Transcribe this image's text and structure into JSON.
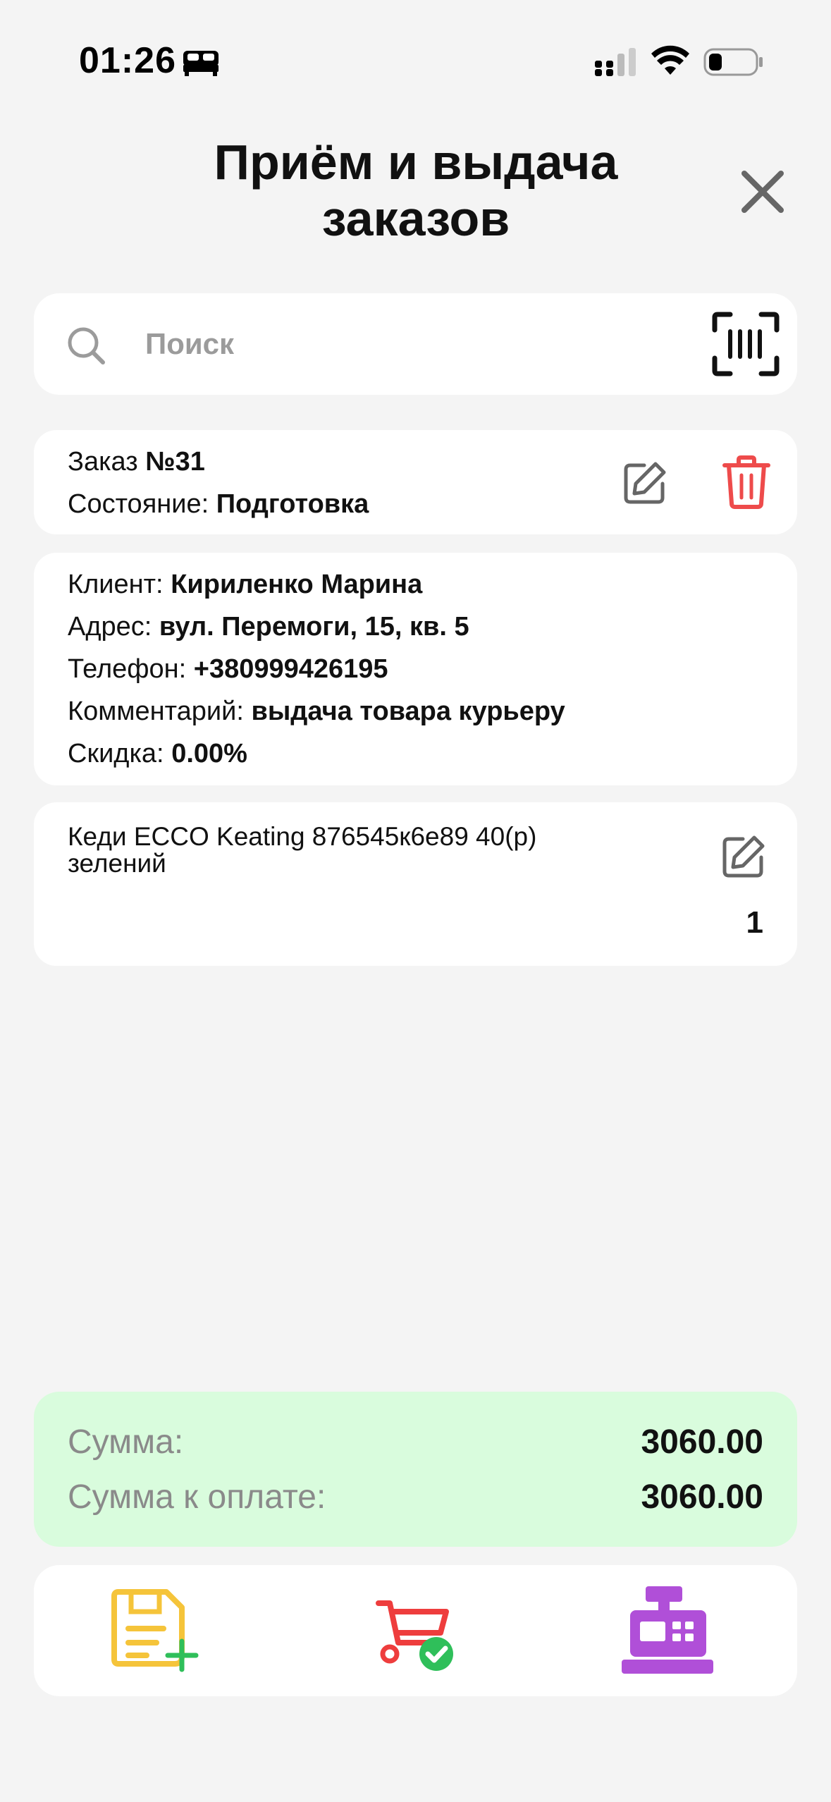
{
  "status_bar": {
    "time": "01:26",
    "mode_icon": "bed-icon",
    "icons": [
      "signal-icon",
      "wifi-icon",
      "battery-icon"
    ]
  },
  "header": {
    "title": "Приём и выдача заказов",
    "close_icon": "close-icon"
  },
  "search": {
    "placeholder": "Поиск",
    "value": "",
    "scan_icon": "barcode-scan-icon"
  },
  "order": {
    "number_label": "Заказ",
    "number_value": "№31",
    "state_label": "Состояние:",
    "state_value": "Подготовка"
  },
  "client": {
    "name_label": "Клиент:",
    "name_value": "Кириленко Марина",
    "address_label": "Адрес:",
    "address_value": "вул. Перемоги, 15, кв. 5",
    "phone_label": "Телефон:",
    "phone_value": "+380999426195",
    "comment_label": "Комментарий:",
    "comment_value": "выдача товара курьеру",
    "discount_label": "Скидка:",
    "discount_value": "0.00%"
  },
  "items": [
    {
      "name": "Кеди ECCO Keating 876545к6е89 40(р) зелений",
      "quantity": "1"
    }
  ],
  "totals": {
    "sum_label": "Сумма:",
    "sum_value": "3060.00",
    "to_pay_label": "Сумма к оплате:",
    "to_pay_value": "3060.00"
  },
  "actions": [
    {
      "icon": "new-document-icon",
      "color": "#f5c43a",
      "accent": "#2fbf5a"
    },
    {
      "icon": "cart-check-icon",
      "color": "#ee3d3d",
      "accent": "#2fbf5a"
    },
    {
      "icon": "cash-register-icon",
      "color": "#b04fd8"
    }
  ],
  "colors": {
    "background": "#f4f4f4",
    "card": "#ffffff",
    "totals_bg": "#d9fcdd",
    "delete": "#ee4b4b",
    "muted_text": "#8a8a8a"
  }
}
